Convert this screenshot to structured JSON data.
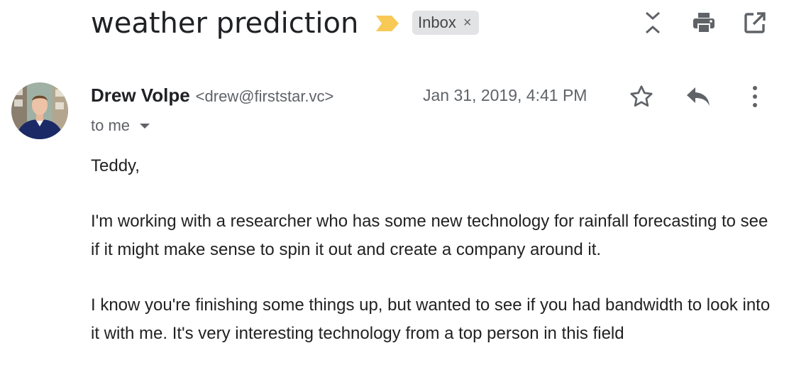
{
  "header": {
    "subject": "weather prediction",
    "label": "Inbox",
    "label_remove": "×"
  },
  "icons": {
    "importance": "importance-marker-icon",
    "expand_collapse": "expand-collapse-icon",
    "print": "printer-icon",
    "new_window": "open-in-new-window-icon",
    "star": "star-icon",
    "reply": "reply-icon",
    "more": "more-vertical-icon",
    "caret": "caret-down-icon"
  },
  "message": {
    "sender_name": "Drew Volpe",
    "sender_email": "<drew@firststar.vc>",
    "date": "Jan 31, 2019, 4:41 PM",
    "recipients": "to me",
    "body": [
      "Teddy,",
      "I'm working with a researcher who has some new technology for rainfall forecasting to see if it might make sense to spin it out and create a company around it.",
      "I know you're finishing some things up, but wanted to see if you had bandwidth to look into it with me. It's very interesting technology from a top person in this field"
    ]
  },
  "colors": {
    "importance": "#f8c955",
    "label_bg": "#e2e3e5",
    "icon": "#5f6368"
  }
}
